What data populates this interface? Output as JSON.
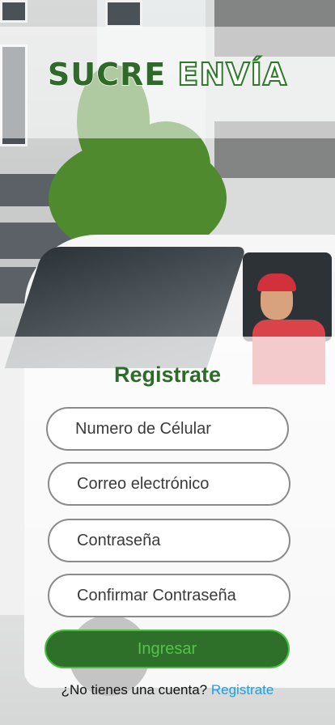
{
  "brand": {
    "word1": "SUCRE",
    "word2": "ENVÍA"
  },
  "form": {
    "title": "Registrate",
    "fields": [
      {
        "placeholder": "Numero de Célular"
      },
      {
        "placeholder": "Correo electrónico"
      },
      {
        "placeholder": "Contraseña"
      },
      {
        "placeholder": "Confirmar Contraseña"
      }
    ],
    "submit_label": "Ingresar"
  },
  "footer": {
    "question": "¿No tienes una cuenta?",
    "link_label": "Registrate"
  },
  "colors": {
    "brand_green": "#2e6b2a",
    "button_green": "#2e6f2a",
    "link_blue": "#1aa0e0"
  }
}
